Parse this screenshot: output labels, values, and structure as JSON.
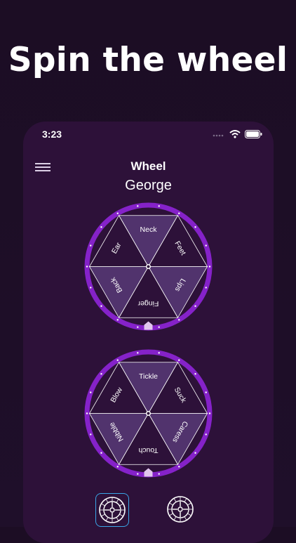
{
  "headline": "Spin the wheel",
  "status": {
    "time": "3:23"
  },
  "nav": {
    "title": "Wheel"
  },
  "player": "George",
  "colors": {
    "background": "#1c0d24",
    "panel": "#2d1139",
    "rim": "#8522c9",
    "slice_light": "#51336d",
    "slice_dark": "#2d1139",
    "indicator": "#e1c6ee"
  },
  "wheel1": {
    "labels": [
      "Neck",
      "Feet",
      "Lips",
      "Finger",
      "Back",
      "Ear"
    ]
  },
  "wheel2": {
    "labels": [
      "Tickle",
      "Suck",
      "Caress",
      "Touch",
      "Nibble",
      "Blow"
    ]
  },
  "buttons": [
    {
      "icon": "roulette-icon",
      "selected": true
    },
    {
      "icon": "roulette-icon",
      "selected": false
    }
  ]
}
